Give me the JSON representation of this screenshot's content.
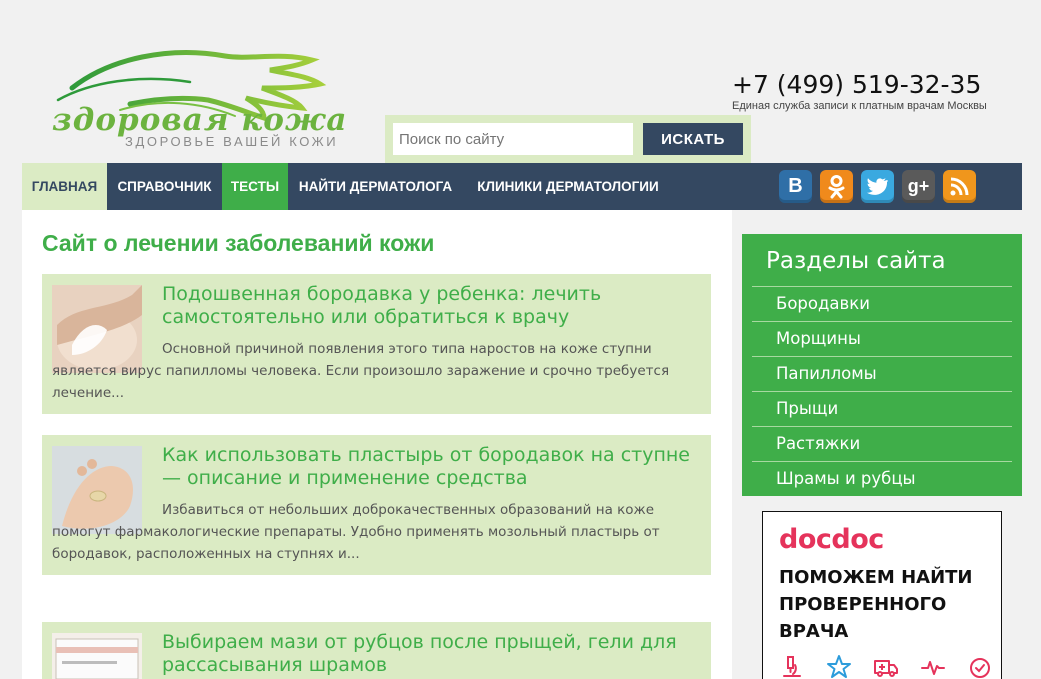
{
  "header": {
    "logo_text": "здоровая кожа",
    "logo_sub": "ЗДОРОВЬЕ ВАШЕЙ КОЖИ",
    "phone": "+7 (499) 519-32-35",
    "phone_sub": "Единая служба записи к платным врачам Москвы",
    "search_placeholder": "Поиск по сайту",
    "search_button": "ИСКАТЬ"
  },
  "nav": {
    "items": [
      {
        "label": "ГЛАВНАЯ"
      },
      {
        "label": "СПРАВОЧНИК"
      },
      {
        "label": "ТЕСТЫ"
      },
      {
        "label": "НАЙТИ ДЕРМАТОЛОГА"
      },
      {
        "label": "КЛИНИКИ ДЕРМАТОЛОГИИ"
      }
    ],
    "social": [
      {
        "label": "В",
        "icon": "vk-icon",
        "color": "#2f6fa7"
      },
      {
        "label": "",
        "icon": "odnoklassniki-icon",
        "color": "#f08a1c"
      },
      {
        "label": "",
        "icon": "twitter-icon",
        "color": "#3aa9e0"
      },
      {
        "label": "g+",
        "icon": "google-plus-icon",
        "color": "#5a5a5a"
      },
      {
        "label": "",
        "icon": "rss-icon",
        "color": "#f0961c"
      }
    ]
  },
  "main": {
    "title": "Сайт о лечении заболеваний кожи",
    "articles": [
      {
        "title": "Подошвенная бородавка у ребенка: лечить самостоятельно или обратиться к врачу",
        "text": "Основной причиной появления этого типа наростов на коже ступни является вирус папилломы человека. Если произошло заражение и срочно требуется лечение..."
      },
      {
        "title": "Как использовать пластырь от бородавок на ступне — описание и применение средства",
        "text": "Избавиться от небольших доброкачественных образований на коже помогут фармакологические препараты. Удобно применять мозольный пластырь от бородавок, расположенных на ступнях и..."
      },
      {
        "title": "Выбираем мази от рубцов после прыщей, гели для рассасывания шрамов",
        "text": ""
      }
    ]
  },
  "sidebar": {
    "title": "Разделы сайта",
    "items": [
      {
        "label": "Бородавки"
      },
      {
        "label": "Морщины"
      },
      {
        "label": "Папилломы"
      },
      {
        "label": "Прыщи"
      },
      {
        "label": "Растяжки"
      },
      {
        "label": "Шрамы и рубцы"
      }
    ]
  },
  "ad": {
    "logo": "docdoc",
    "text": "ПОМОЖЕМ НАЙТИ ПРОВЕРЕННОГО ВРАЧА",
    "icons": [
      "microscope-icon",
      "star-icon",
      "ambulance-icon",
      "heartbeat-icon",
      "clock-icon"
    ]
  },
  "colors": {
    "green": "#3fae49",
    "light_green": "#dbebc4",
    "navy": "#344861"
  }
}
